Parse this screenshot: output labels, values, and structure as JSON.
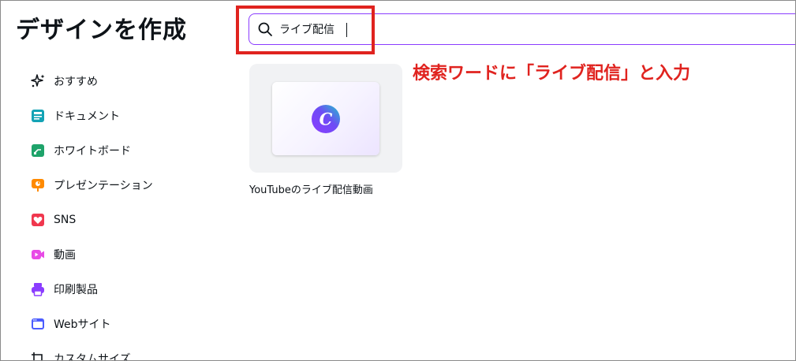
{
  "page_title": "デザインを作成",
  "search": {
    "value": "ライブ配信"
  },
  "annotation": "検索ワードに「ライブ配信」と入力",
  "sidebar": {
    "items": [
      {
        "label": "おすすめ",
        "icon": "sparkle-icon",
        "color": "#0e1318"
      },
      {
        "label": "ドキュメント",
        "icon": "document-icon",
        "color": "#13a3b5"
      },
      {
        "label": "ホワイトボード",
        "icon": "whiteboard-icon",
        "color": "#1ea36a"
      },
      {
        "label": "プレゼンテーション",
        "icon": "presentation-icon",
        "color": "#ff8a00"
      },
      {
        "label": "SNS",
        "icon": "heart-icon",
        "color": "#f0374e"
      },
      {
        "label": "動画",
        "icon": "video-icon",
        "color": "#e84ae6"
      },
      {
        "label": "印刷製品",
        "icon": "printer-icon",
        "color": "#8b3dff"
      },
      {
        "label": "Webサイト",
        "icon": "website-icon",
        "color": "#4b5cff"
      },
      {
        "label": "カスタムサイズ",
        "icon": "custom-size-icon",
        "color": "#0e1318"
      }
    ]
  },
  "results": [
    {
      "label": "YouTubeのライブ配信動画",
      "logo_letter": "C"
    }
  ],
  "colors": {
    "accent": "#8b3dff",
    "highlight": "#e0231f"
  }
}
